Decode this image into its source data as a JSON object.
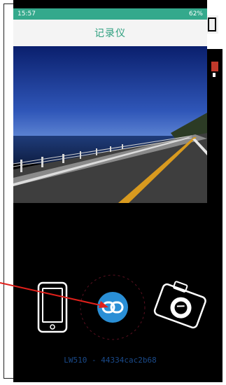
{
  "status_bar": {
    "time": "15:57",
    "battery": "62%"
  },
  "title_bar": {
    "title": "记录仪"
  },
  "controls": {
    "phone_icon": "phone-icon",
    "link_icon": "link-icon",
    "camera_icon": "camera-icon"
  },
  "device": {
    "id_text": "LW510 - 44334cac2b68"
  },
  "colors": {
    "status_bar_bg": "#34a98c",
    "title_color": "#2e9f7f",
    "link_button": "#2a8fd6",
    "arrow": "#e0201b"
  }
}
